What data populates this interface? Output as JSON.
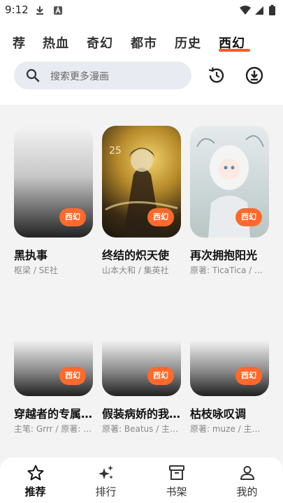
{
  "status_bar": {
    "time": "9:12"
  },
  "tabs": [
    {
      "label": "荐"
    },
    {
      "label": "热血"
    },
    {
      "label": "奇幻"
    },
    {
      "label": "都市"
    },
    {
      "label": "历史"
    },
    {
      "label": "西幻",
      "active": true
    }
  ],
  "search": {
    "placeholder": "搜索更多漫画"
  },
  "comics": [
    {
      "title": "黑执事",
      "author": "枢梁 / SE社",
      "badge": "西幻",
      "cover": "faded"
    },
    {
      "title": "终结的炽天使",
      "author": "山本大和 / 集英社",
      "badge": "西幻",
      "cover": "art1"
    },
    {
      "title": "再次拥抱阳光",
      "author": "原著: TicaTica / ...",
      "badge": "西幻",
      "cover": "art2"
    },
    {
      "title": "穿越者的专属…",
      "author": "主笔: Grrr / 原著: I...",
      "badge": "西幻",
      "cover": "fadeshort"
    },
    {
      "title": "假装病娇的我…",
      "author": "原著: Beatus / 主…",
      "badge": "西幻",
      "cover": "fadeshort"
    },
    {
      "title": "枯枝咏叹调",
      "author": "原著: muze / 主…",
      "badge": "西幻",
      "cover": "fadeshort"
    }
  ],
  "bottom_nav": [
    {
      "label": "推荐",
      "icon": "star-icon",
      "active": true
    },
    {
      "label": "排行",
      "icon": "sparkle-icon"
    },
    {
      "label": "书架",
      "icon": "archive-icon"
    },
    {
      "label": "我的",
      "icon": "person-icon"
    }
  ],
  "colors": {
    "accent": "#ff6a2c",
    "tab_underline": "#ff5a2a",
    "search_bg": "#e8ebf2"
  }
}
